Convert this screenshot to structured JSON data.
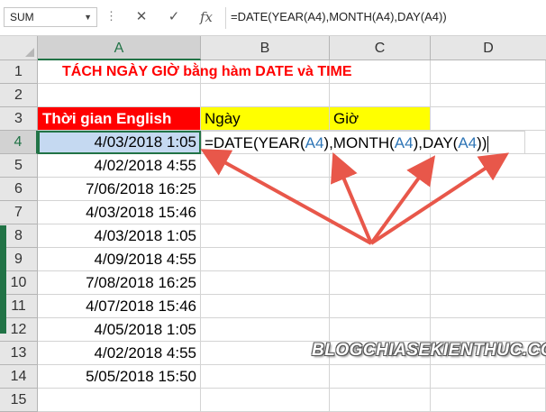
{
  "formula_bar": {
    "name_box": "SUM",
    "cancel_icon": "✕",
    "enter_icon": "✓",
    "fx_label": "fx",
    "formula": "=DATE(YEAR(A4),MONTH(A4),DAY(A4))"
  },
  "columns": [
    "A",
    "B",
    "C",
    "D"
  ],
  "rows": [
    "1",
    "2",
    "3",
    "4",
    "5",
    "6",
    "7",
    "8",
    "9",
    "10",
    "11",
    "12",
    "13",
    "14",
    "15"
  ],
  "sheet": {
    "title": "TÁCH NGÀY GIỜ bằng hàm DATE và TIME",
    "header_a": "Thời gian English",
    "header_b": "Ngày",
    "header_c": "Giờ",
    "editing": {
      "prefix": "=DATE(YEAR(",
      "ref1": "A4",
      "mid1": "),MONTH(",
      "ref2": "A4",
      "mid2": "),DAY(",
      "ref3": "A4",
      "suffix": "))"
    },
    "values": [
      "4/03/2018 1:05",
      "4/02/2018 4:55",
      "7/06/2018 16:25",
      "4/03/2018 15:46",
      "4/03/2018 1:05",
      "4/09/2018 4:55",
      "7/08/2018 16:25",
      "4/07/2018 15:46",
      "4/05/2018 1:05",
      "4/02/2018 4:55",
      "5/05/2018 15:50"
    ]
  },
  "watermark": "BLOGCHIASEKIENTHUC.COM",
  "colors": {
    "arrow": "#e8574a",
    "excel_green": "#217346",
    "header_red": "#ff0000",
    "header_yellow": "#ffff00"
  }
}
